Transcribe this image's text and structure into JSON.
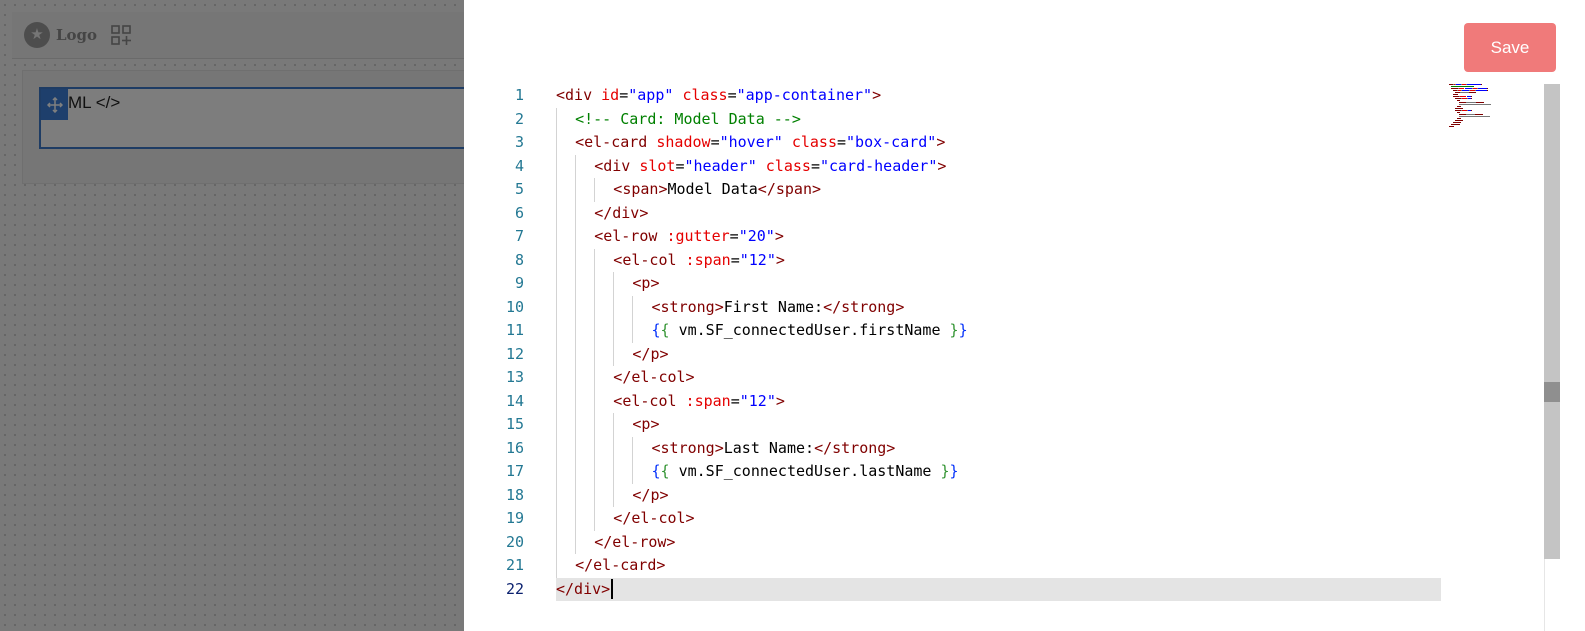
{
  "background": {
    "logo_text": "Logo",
    "block_label": "ML </>"
  },
  "drawer": {
    "save_label": "Save",
    "code_lines": [
      [
        [
          "tag",
          "<div"
        ],
        [
          "txt",
          " "
        ],
        [
          "attr",
          "id"
        ],
        [
          "txt",
          "="
        ],
        [
          "val",
          "\"app\""
        ],
        [
          "txt",
          " "
        ],
        [
          "attr",
          "class"
        ],
        [
          "txt",
          "="
        ],
        [
          "val",
          "\"app-container\""
        ],
        [
          "tag",
          ">"
        ]
      ],
      [
        [
          "comment",
          "<!-- Card: Model Data -->"
        ]
      ],
      [
        [
          "tag",
          "<el-card"
        ],
        [
          "txt",
          " "
        ],
        [
          "attr",
          "shadow"
        ],
        [
          "txt",
          "="
        ],
        [
          "val",
          "\"hover\""
        ],
        [
          "txt",
          " "
        ],
        [
          "attr",
          "class"
        ],
        [
          "txt",
          "="
        ],
        [
          "val",
          "\"box-card\""
        ],
        [
          "tag",
          ">"
        ]
      ],
      [
        [
          "tag",
          "<div"
        ],
        [
          "txt",
          " "
        ],
        [
          "attr",
          "slot"
        ],
        [
          "txt",
          "="
        ],
        [
          "val",
          "\"header\""
        ],
        [
          "txt",
          " "
        ],
        [
          "attr",
          "class"
        ],
        [
          "txt",
          "="
        ],
        [
          "val",
          "\"card-header\""
        ],
        [
          "tag",
          ">"
        ]
      ],
      [
        [
          "tag",
          "<span>"
        ],
        [
          "txt",
          "Model Data"
        ],
        [
          "tag",
          "</span>"
        ]
      ],
      [
        [
          "tag",
          "</div>"
        ]
      ],
      [
        [
          "tag",
          "<el-row"
        ],
        [
          "txt",
          " "
        ],
        [
          "attr",
          ":gutter"
        ],
        [
          "txt",
          "="
        ],
        [
          "val",
          "\"20\""
        ],
        [
          "tag",
          ">"
        ]
      ],
      [
        [
          "tag",
          "<el-col"
        ],
        [
          "txt",
          " "
        ],
        [
          "attr",
          ":span"
        ],
        [
          "txt",
          "="
        ],
        [
          "val",
          "\"12\""
        ],
        [
          "tag",
          ">"
        ]
      ],
      [
        [
          "tag",
          "<p>"
        ]
      ],
      [
        [
          "tag",
          "<strong>"
        ],
        [
          "txt",
          "First Name:"
        ],
        [
          "tag",
          "</strong>"
        ]
      ],
      [
        [
          "b1",
          "{"
        ],
        [
          "b2",
          "{"
        ],
        [
          "txt",
          " vm.SF_connectedUser.firstName "
        ],
        [
          "b2",
          "}"
        ],
        [
          "b1",
          "}"
        ]
      ],
      [
        [
          "tag",
          "</p>"
        ]
      ],
      [
        [
          "tag",
          "</el-col>"
        ]
      ],
      [
        [
          "tag",
          "<el-col"
        ],
        [
          "txt",
          " "
        ],
        [
          "attr",
          ":span"
        ],
        [
          "txt",
          "="
        ],
        [
          "val",
          "\"12\""
        ],
        [
          "tag",
          ">"
        ]
      ],
      [
        [
          "tag",
          "<p>"
        ]
      ],
      [
        [
          "tag",
          "<strong>"
        ],
        [
          "txt",
          "Last Name:"
        ],
        [
          "tag",
          "</strong>"
        ]
      ],
      [
        [
          "b1",
          "{"
        ],
        [
          "b2",
          "{"
        ],
        [
          "txt",
          " vm.SF_connectedUser.lastName "
        ],
        [
          "b2",
          "}"
        ],
        [
          "b1",
          "}"
        ]
      ],
      [
        [
          "tag",
          "</p>"
        ]
      ],
      [
        [
          "tag",
          "</el-col>"
        ]
      ],
      [
        [
          "tag",
          "</el-row>"
        ]
      ],
      [
        [
          "tag",
          "</el-card>"
        ]
      ],
      [
        [
          "tag",
          "</div>"
        ]
      ]
    ]
  },
  "colors": {
    "save_button": "#f07a7a",
    "tag": "#800000",
    "attribute": "#e50000",
    "value": "#0000ff",
    "comment": "#008000",
    "line_number": "#237893"
  }
}
